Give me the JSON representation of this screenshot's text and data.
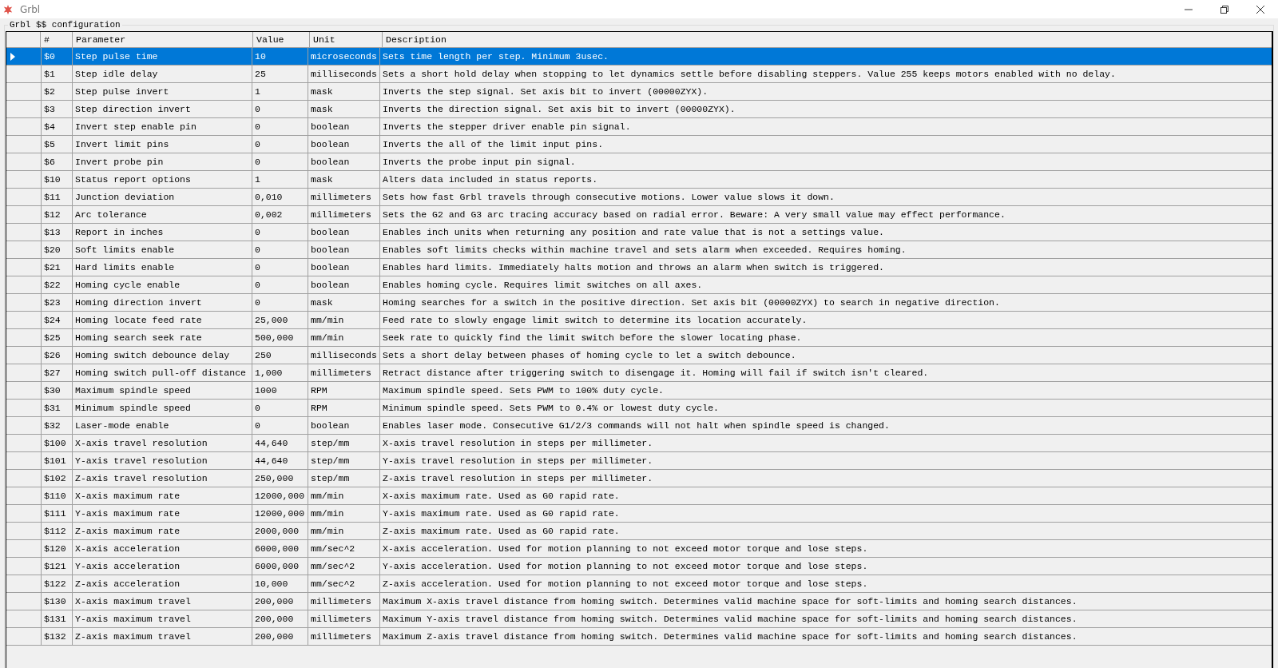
{
  "window": {
    "title": "Grbl"
  },
  "group": {
    "label": "Grbl $$ configuration"
  },
  "table": {
    "columns": [
      "#",
      "Parameter",
      "Value",
      "Unit",
      "Description"
    ],
    "rows": [
      {
        "cells": [
          "$0",
          "Step pulse time",
          "10",
          "microseconds",
          "Sets time length per step. Minimum 3usec."
        ],
        "selected": true
      },
      {
        "cells": [
          "$1",
          "Step idle delay",
          "25",
          "milliseconds",
          "Sets a short hold delay when stopping to let dynamics settle before disabling steppers. Value 255 keeps motors enabled with no delay."
        ],
        "selected": false
      },
      {
        "cells": [
          "$2",
          "Step pulse invert",
          "1",
          "mask",
          "Inverts the step signal. Set axis bit to invert (00000ZYX)."
        ],
        "selected": false
      },
      {
        "cells": [
          "$3",
          "Step direction invert",
          "0",
          "mask",
          "Inverts the direction signal. Set axis bit to invert (00000ZYX)."
        ],
        "selected": false
      },
      {
        "cells": [
          "$4",
          "Invert step enable pin",
          "0",
          "boolean",
          "Inverts the stepper driver enable pin signal."
        ],
        "selected": false
      },
      {
        "cells": [
          "$5",
          "Invert limit pins",
          "0",
          "boolean",
          "Inverts the all of the limit input pins."
        ],
        "selected": false
      },
      {
        "cells": [
          "$6",
          "Invert probe pin",
          "0",
          "boolean",
          "Inverts the probe input pin signal."
        ],
        "selected": false
      },
      {
        "cells": [
          "$10",
          "Status report options",
          "1",
          "mask",
          "Alters data included in status reports."
        ],
        "selected": false
      },
      {
        "cells": [
          "$11",
          "Junction deviation",
          "0,010",
          "millimeters",
          "Sets how fast Grbl travels through consecutive motions. Lower value slows it down."
        ],
        "selected": false
      },
      {
        "cells": [
          "$12",
          "Arc tolerance",
          "0,002",
          "millimeters",
          "Sets the G2 and G3 arc tracing accuracy based on radial error. Beware: A very small value may effect performance."
        ],
        "selected": false
      },
      {
        "cells": [
          "$13",
          "Report in inches",
          "0",
          "boolean",
          "Enables inch units when returning any position and rate value that is not a settings value."
        ],
        "selected": false
      },
      {
        "cells": [
          "$20",
          "Soft limits enable",
          "0",
          "boolean",
          "Enables soft limits checks within machine travel and sets alarm when exceeded. Requires homing."
        ],
        "selected": false
      },
      {
        "cells": [
          "$21",
          "Hard limits enable",
          "0",
          "boolean",
          "Enables hard limits. Immediately halts motion and throws an alarm when switch is triggered."
        ],
        "selected": false
      },
      {
        "cells": [
          "$22",
          "Homing cycle enable",
          "0",
          "boolean",
          "Enables homing cycle. Requires limit switches on all axes."
        ],
        "selected": false
      },
      {
        "cells": [
          "$23",
          "Homing direction invert",
          "0",
          "mask",
          "Homing searches for a switch in the positive direction. Set axis bit (00000ZYX) to search in negative direction."
        ],
        "selected": false
      },
      {
        "cells": [
          "$24",
          "Homing locate feed rate",
          "25,000",
          "mm/min",
          "Feed rate to slowly engage limit switch to determine its location accurately."
        ],
        "selected": false
      },
      {
        "cells": [
          "$25",
          "Homing search seek rate",
          "500,000",
          "mm/min",
          "Seek rate to quickly find the limit switch before the slower locating phase."
        ],
        "selected": false
      },
      {
        "cells": [
          "$26",
          "Homing switch debounce delay",
          "250",
          "milliseconds",
          "Sets a short delay between phases of homing cycle to let a switch debounce."
        ],
        "selected": false
      },
      {
        "cells": [
          "$27",
          "Homing switch pull-off distance",
          "1,000",
          "millimeters",
          "Retract distance after triggering switch to disengage it. Homing will fail if switch isn't cleared."
        ],
        "selected": false
      },
      {
        "cells": [
          "$30",
          "Maximum spindle speed",
          "1000",
          "RPM",
          "Maximum spindle speed. Sets PWM to 100% duty cycle."
        ],
        "selected": false
      },
      {
        "cells": [
          "$31",
          "Minimum spindle speed",
          "0",
          "RPM",
          "Minimum spindle speed. Sets PWM to 0.4% or lowest duty cycle."
        ],
        "selected": false
      },
      {
        "cells": [
          "$32",
          "Laser-mode enable",
          "0",
          "boolean",
          "Enables laser mode. Consecutive G1/2/3 commands will not halt when spindle speed is changed."
        ],
        "selected": false
      },
      {
        "cells": [
          "$100",
          "X-axis travel resolution",
          "44,640",
          "step/mm",
          "X-axis travel resolution in steps per millimeter."
        ],
        "selected": false
      },
      {
        "cells": [
          "$101",
          "Y-axis travel resolution",
          "44,640",
          "step/mm",
          "Y-axis travel resolution in steps per millimeter."
        ],
        "selected": false
      },
      {
        "cells": [
          "$102",
          "Z-axis travel resolution",
          "250,000",
          "step/mm",
          "Z-axis travel resolution in steps per millimeter."
        ],
        "selected": false
      },
      {
        "cells": [
          "$110",
          "X-axis maximum rate",
          "12000,000",
          "mm/min",
          "X-axis maximum rate. Used as G0 rapid rate."
        ],
        "selected": false
      },
      {
        "cells": [
          "$111",
          "Y-axis maximum rate",
          "12000,000",
          "mm/min",
          "Y-axis maximum rate. Used as G0 rapid rate."
        ],
        "selected": false
      },
      {
        "cells": [
          "$112",
          "Z-axis maximum rate",
          "2000,000",
          "mm/min",
          "Z-axis maximum rate. Used as G0 rapid rate."
        ],
        "selected": false
      },
      {
        "cells": [
          "$120",
          "X-axis acceleration",
          "6000,000",
          "mm/sec^2",
          "X-axis acceleration. Used for motion planning to not exceed motor torque and lose steps."
        ],
        "selected": false
      },
      {
        "cells": [
          "$121",
          "Y-axis acceleration",
          "6000,000",
          "mm/sec^2",
          "Y-axis acceleration. Used for motion planning to not exceed motor torque and lose steps."
        ],
        "selected": false
      },
      {
        "cells": [
          "$122",
          "Z-axis acceleration",
          "10,000",
          "mm/sec^2",
          "Z-axis acceleration. Used for motion planning to not exceed motor torque and lose steps."
        ],
        "selected": false
      },
      {
        "cells": [
          "$130",
          "X-axis maximum travel",
          "200,000",
          "millimeters",
          "Maximum X-axis travel distance from homing switch. Determines valid machine space for soft-limits and homing search distances."
        ],
        "selected": false
      },
      {
        "cells": [
          "$131",
          "Y-axis maximum travel",
          "200,000",
          "millimeters",
          "Maximum Y-axis travel distance from homing switch. Determines valid machine space for soft-limits and homing search distances."
        ],
        "selected": false
      },
      {
        "cells": [
          "$132",
          "Z-axis maximum travel",
          "200,000",
          "millimeters",
          "Maximum Z-axis travel distance from homing switch. Determines valid machine space for soft-limits and homing search distances."
        ],
        "selected": false
      }
    ]
  }
}
